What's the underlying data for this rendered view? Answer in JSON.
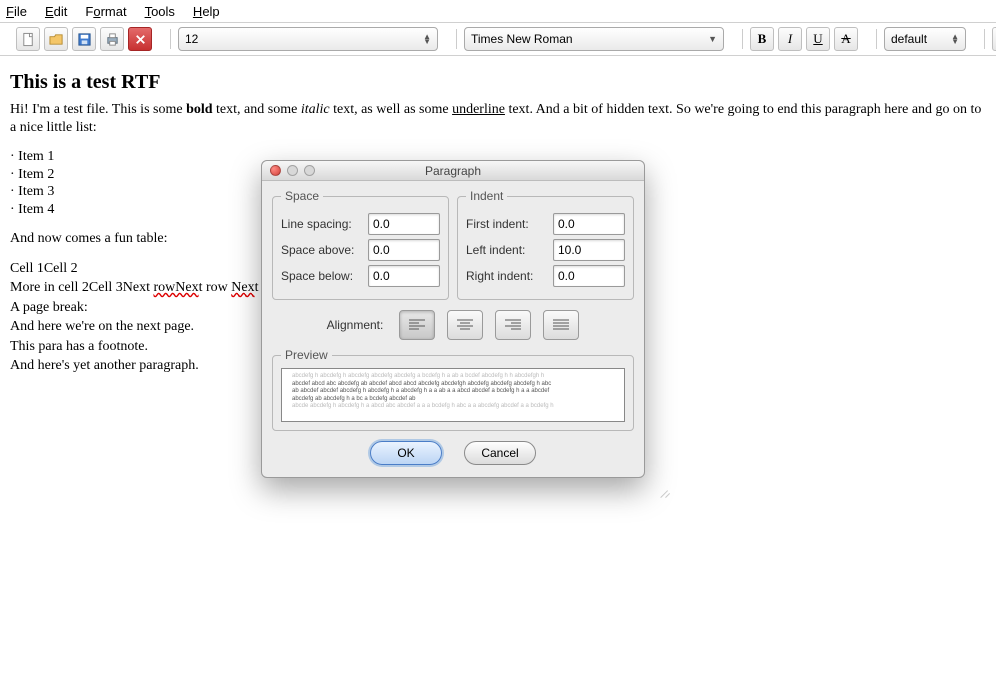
{
  "menu": {
    "items": [
      {
        "pre": "",
        "ul": "F",
        "post": "ile"
      },
      {
        "pre": "",
        "ul": "E",
        "post": "dit"
      },
      {
        "pre": "F",
        "ul": "o",
        "post": "rmat"
      },
      {
        "pre": "",
        "ul": "T",
        "post": "ools"
      },
      {
        "pre": "",
        "ul": "H",
        "post": "elp"
      }
    ]
  },
  "toolbar": {
    "font_size": "12",
    "font_name": "Times New Roman",
    "style_name": "default"
  },
  "doc": {
    "title": "This is a test RTF",
    "p1a": "Hi! I'm a test file. This is some ",
    "p1_bold": "bold",
    "p1b": " text, and some ",
    "p1_italic": "italic",
    "p1c": " text, as well as some ",
    "p1_ul": "underline",
    "p1d": " text. And a bit of hidden text. So we're going to end this paragraph here and go on to a nice little list:",
    "items": [
      "· Item 1",
      "· Item 2",
      "· Item 3",
      "· Item 4"
    ],
    "p2": "And now comes a fun table:",
    "tline1": "Cell 1Cell 2",
    "tline2a": "More in cell 2Cell 3Next ",
    "tline2_sq1": "rowNex",
    "tline2b": "t row ",
    "tline2_sq2": "Nex",
    "tline2c": "t row",
    "p3": "A page break:",
    "p4": "And here we're on the next page.",
    "p5": "This para has a footnote.",
    "p6": "And here's yet another paragraph."
  },
  "dialog": {
    "title": "Paragraph",
    "space_legend": "Space",
    "indent_legend": "Indent",
    "labels": {
      "line_spacing": "Line spacing:",
      "space_above": "Space above:",
      "space_below": "Space below:",
      "first_indent": "First indent:",
      "left_indent": "Left indent:",
      "right_indent": "Right indent:",
      "alignment": "Alignment:",
      "preview": "Preview"
    },
    "values": {
      "line_spacing": "0.0",
      "space_above": "0.0",
      "space_below": "0.0",
      "first_indent": "0.0",
      "left_indent": "10.0",
      "right_indent": "0.0"
    },
    "preview_grey": "abcdefg h abcdefg h abcdefg abcdefg abcdefg a bcdefg h a ab a bcdef abcdefg h h abcdefgh h",
    "preview_main1": "abcdef abcd abc abcdefg ab abcdef abcd abcd abcdefg abcdefgh abcdefg abcdefg abcdefg h abc",
    "preview_main2": "ab abcdef abcdef abcdefg h abcdefg h a abcdefg h a a ab a a abcd abcdef a bcdefg h a a abcdef",
    "preview_main3": "abcdefg ab abcdefg h a bc a bcdefg abcdef ab",
    "preview_grey2": "abcde abcdefg h abcdefg h a abcd abc abcdef a a a bcdefg h abc a a abcdefg abcdef a a bcdefg h",
    "buttons": {
      "ok": "OK",
      "cancel": "Cancel"
    }
  }
}
